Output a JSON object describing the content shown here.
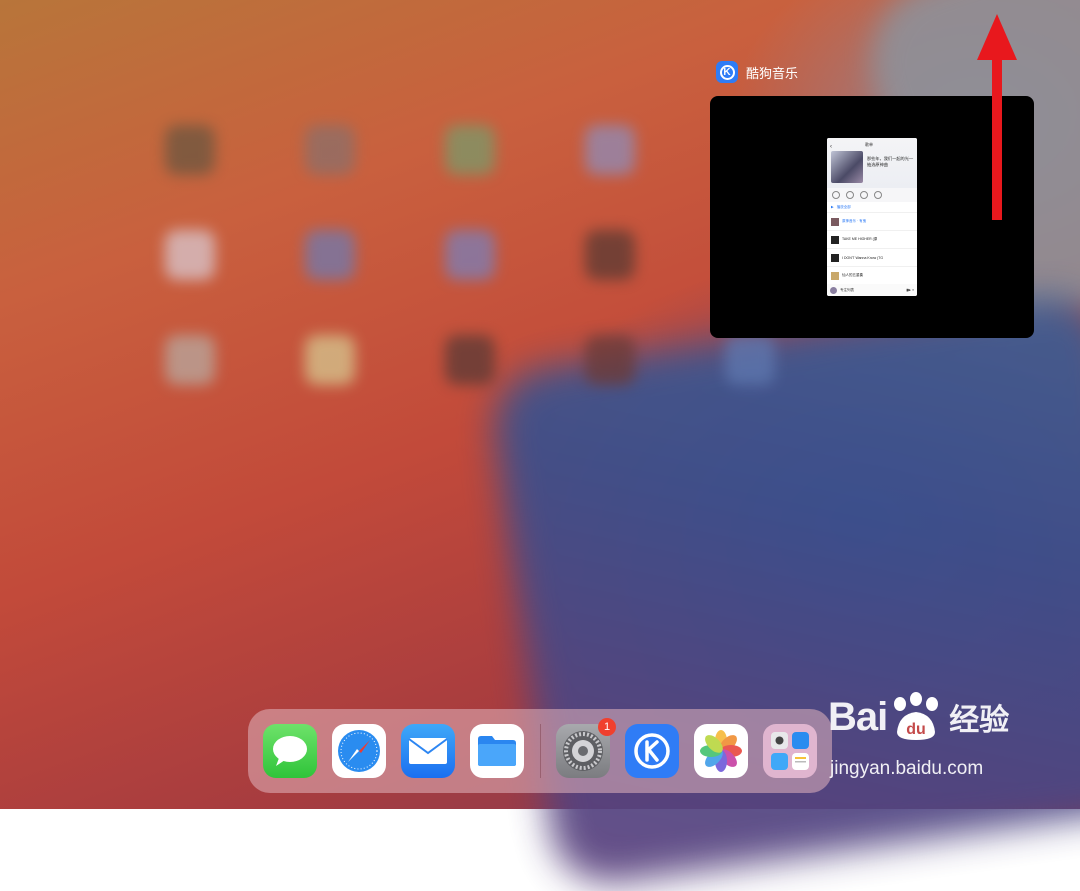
{
  "app_switcher": {
    "app_name": "酷狗音乐",
    "app_icon": "kugou-k-icon",
    "preview": {
      "nav_title": "歌单",
      "playlist_desc": "那些年，我们一起的光—抽选原神曲",
      "toolbar_hint": "播放全部",
      "songs": [
        "原神音乐 · 有鬼",
        "TAKE ME HIGHER (原",
        "I DON'T Wanna Know (TG",
        "仙人的五重奏"
      ],
      "now_playing": "专注列表"
    }
  },
  "dock": {
    "apps": [
      {
        "name": "Messages",
        "icon": "messages-icon"
      },
      {
        "name": "Safari",
        "icon": "safari-icon"
      },
      {
        "name": "Mail",
        "icon": "mail-icon"
      },
      {
        "name": "Files",
        "icon": "files-icon"
      },
      {
        "name": "Settings",
        "icon": "settings-icon",
        "badge": "1"
      },
      {
        "name": "KuGou",
        "icon": "kugou-k-icon"
      },
      {
        "name": "Photos",
        "icon": "photos-icon"
      },
      {
        "name": "App Library",
        "icon": "app-library-icon"
      }
    ]
  },
  "watermark": {
    "bai": "Bai",
    "du": "du",
    "jingyan": "经验",
    "url": "jingyan.baidu.com"
  },
  "colors": {
    "arrow": "#e8181d",
    "kugou_blue": "#2f7cf6",
    "badge": "#f0402e"
  }
}
